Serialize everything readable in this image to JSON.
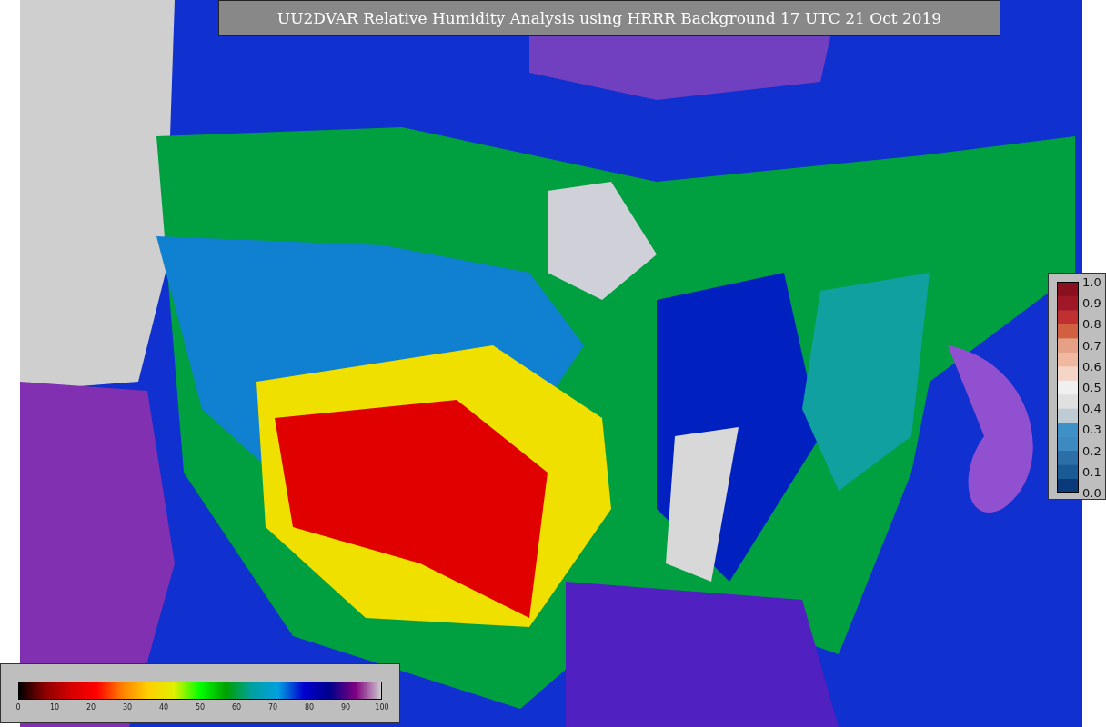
{
  "title": "UU2DVAR Relative Humidity Analysis using HRRR Background 17 UTC 21 Oct 2019",
  "humidity_colorbar": {
    "ticks": [
      "0",
      "10",
      "20",
      "30",
      "40",
      "50",
      "60",
      "70",
      "80",
      "90",
      "100"
    ]
  },
  "error_colorbar": {
    "ticks": [
      "1.0",
      "0.9",
      "0.8",
      "0.7",
      "0.6",
      "0.5",
      "0.4",
      "0.3",
      "0.2",
      "0.1",
      "0.0"
    ]
  }
}
